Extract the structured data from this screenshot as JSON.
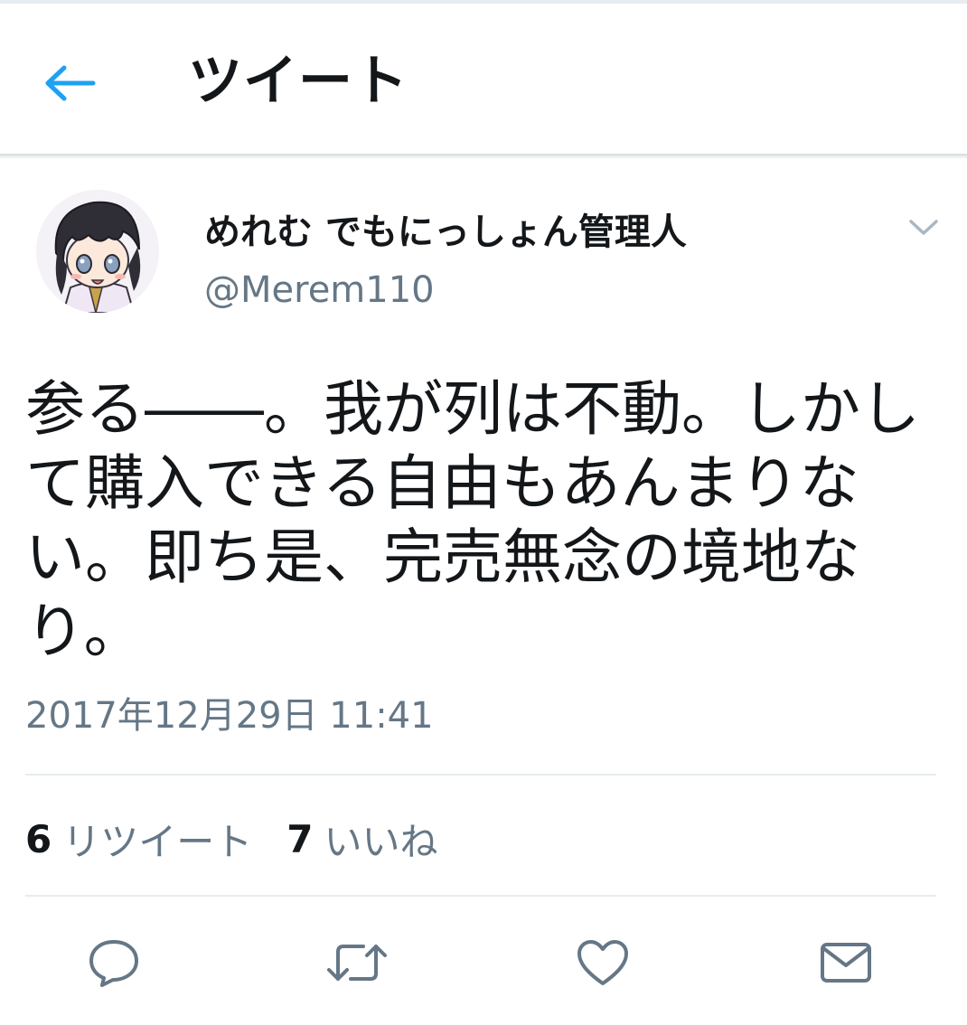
{
  "header": {
    "title": "ツイート",
    "back_icon": "arrow-left-icon",
    "accent_color": "#1da1f2"
  },
  "tweet": {
    "author": {
      "display_name": "めれむ でもにっしょん管理人",
      "handle": "@Merem110",
      "avatar": "anime-character-avatar"
    },
    "menu_icon": "chevron-down-icon",
    "text": "参る――。我が列は不動。しかして購入できる自由もあんまりない。即ち是、完売無念の境地なり。",
    "timestamp": "2017年12月29日 11:41",
    "stats": {
      "retweets": {
        "count": "6",
        "label": "リツイート"
      },
      "likes": {
        "count": "7",
        "label": "いいね"
      }
    },
    "actions": [
      {
        "name": "reply",
        "icon": "reply-icon"
      },
      {
        "name": "retweet",
        "icon": "retweet-icon"
      },
      {
        "name": "like",
        "icon": "heart-icon"
      },
      {
        "name": "share",
        "icon": "envelope-icon"
      }
    ]
  },
  "colors": {
    "text_primary": "#14171a",
    "text_secondary": "#657786",
    "divider": "#e6ecf0"
  }
}
